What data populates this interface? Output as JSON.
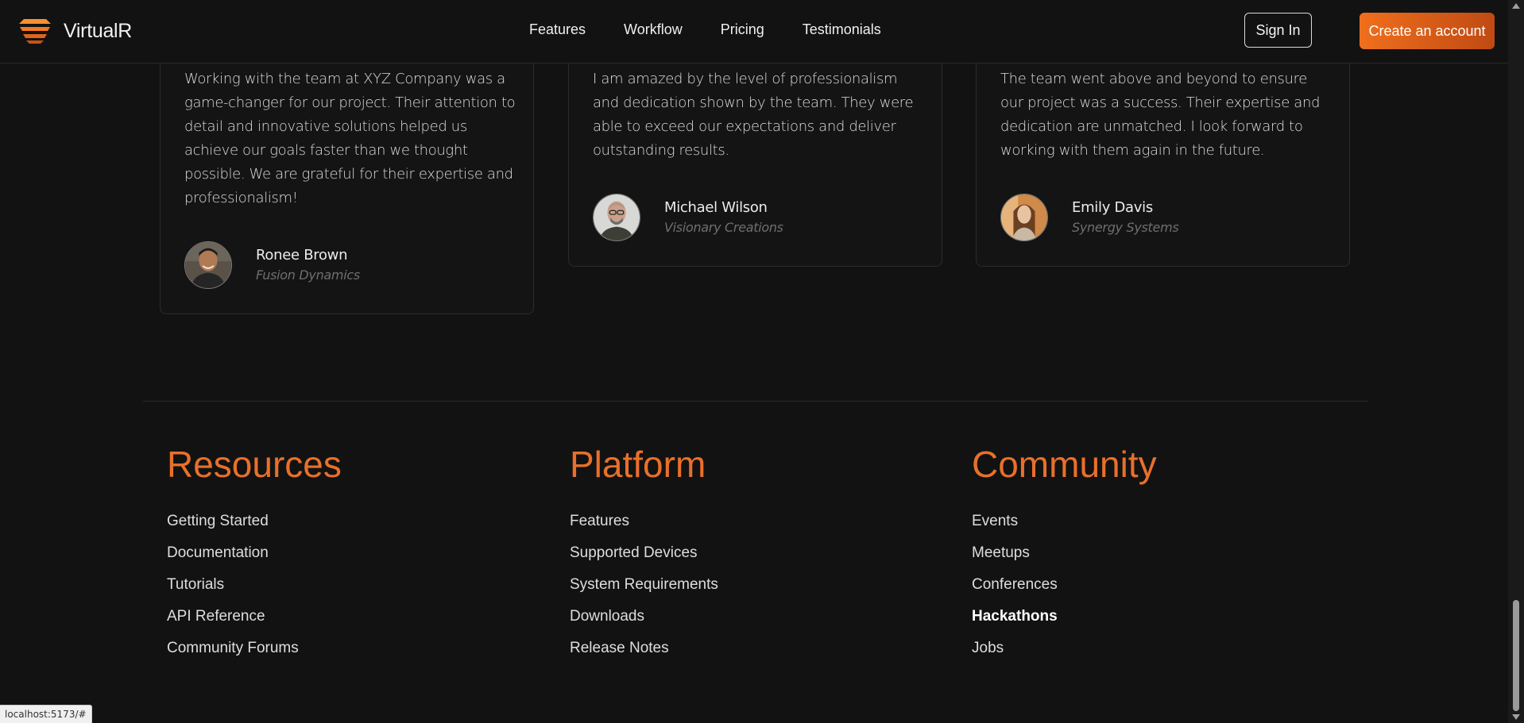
{
  "navbar": {
    "brand": "VirtualR",
    "links": [
      "Features",
      "Workflow",
      "Pricing",
      "Testimonials"
    ],
    "sign_in_label": "Sign In",
    "create_account_label": "Create an account"
  },
  "testimonials": [
    {
      "quote": "Working with the team at XYZ Company was a game-changer for our project. Their attention to detail and innovative solutions helped us achieve our goals faster than we thought possible. We are grateful for their expertise and professionalism!",
      "name": "Ronee Brown",
      "company": "Fusion Dynamics"
    },
    {
      "quote": "I am amazed by the level of professionalism and dedication shown by the team. They were able to exceed our expectations and deliver outstanding results.",
      "name": "Michael Wilson",
      "company": "Visionary Creations"
    },
    {
      "quote": "The team went above and beyond to ensure our project was a success. Their expertise and dedication are unmatched. I look forward to working with them again in the future.",
      "name": "Emily Davis",
      "company": "Synergy Systems"
    }
  ],
  "footer": {
    "columns": [
      {
        "heading": "Resources",
        "links": [
          "Getting Started",
          "Documentation",
          "Tutorials",
          "API Reference",
          "Community Forums"
        ]
      },
      {
        "heading": "Platform",
        "links": [
          "Features",
          "Supported Devices",
          "System Requirements",
          "Downloads",
          "Release Notes"
        ]
      },
      {
        "heading": "Community",
        "links": [
          "Events",
          "Meetups",
          "Conferences",
          "Hackathons",
          "Jobs"
        ]
      }
    ]
  },
  "status_bar": {
    "url": "localhost:5173/#"
  },
  "colors": {
    "accent": "#e8702a",
    "background": "#121212",
    "button_gradient_start": "#f06f1d",
    "button_gradient_end": "#bf4a12"
  },
  "icons": {
    "brand": "virtualr-logo-icon"
  }
}
